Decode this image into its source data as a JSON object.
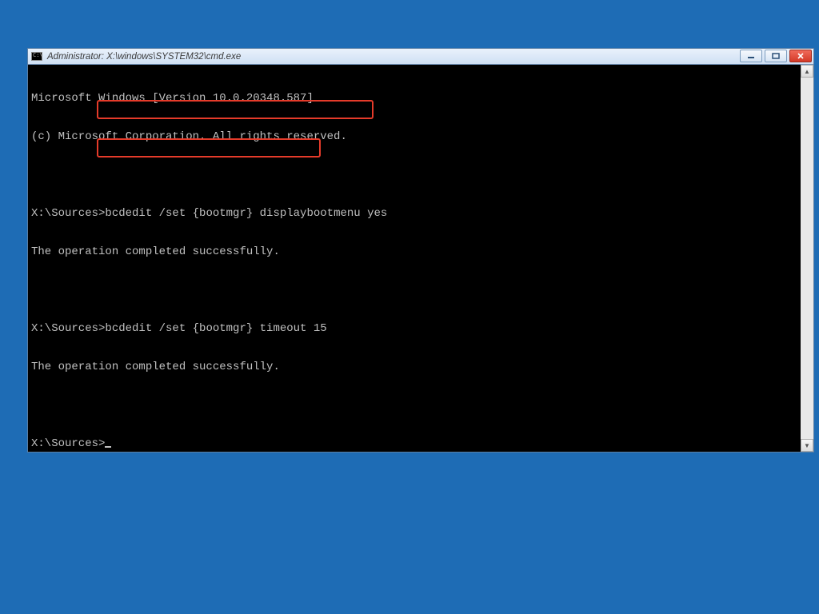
{
  "window": {
    "title": "Administrator: X:\\windows\\SYSTEM32\\cmd.exe"
  },
  "console": {
    "banner_line1": "Microsoft Windows [Version 10.0.20348.587]",
    "banner_line2": "(c) Microsoft Corporation. All rights reserved.",
    "prompt": "X:\\Sources>",
    "cmd1": "bcdedit /set {bootmgr} displaybootmenu yes",
    "result1": "The operation completed successfully.",
    "cmd2": "bcdedit /set {bootmgr} timeout 15",
    "result2": "The operation completed successfully."
  }
}
